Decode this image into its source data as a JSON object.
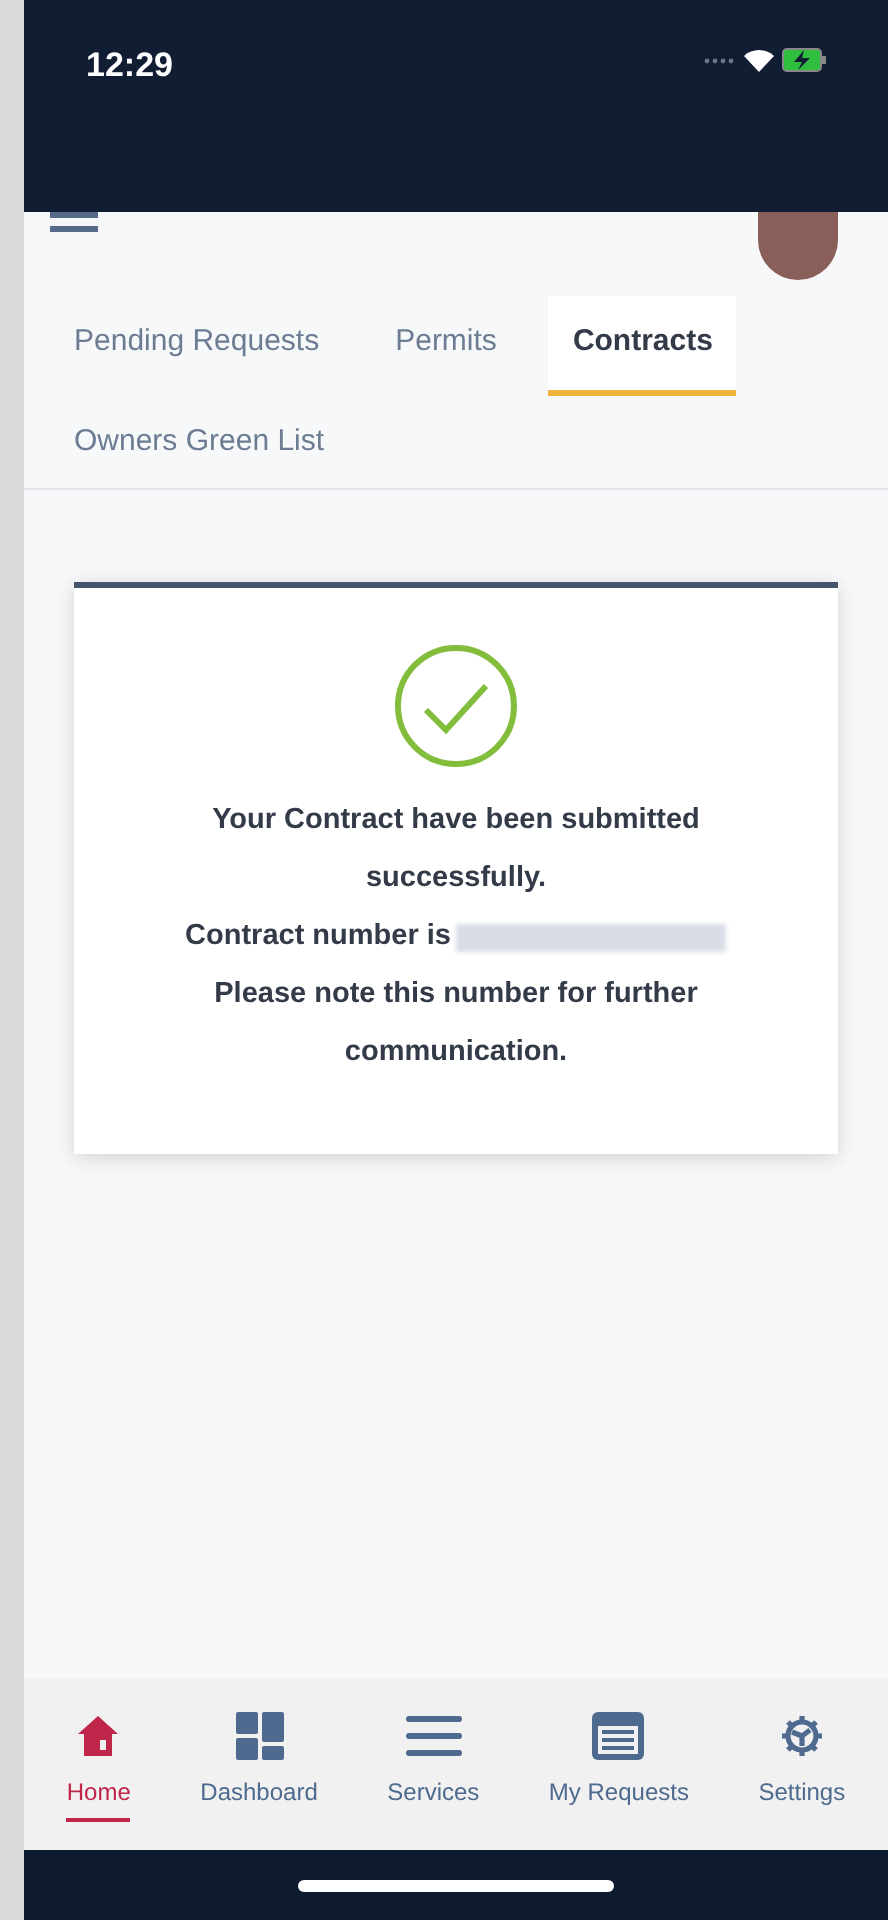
{
  "status_bar": {
    "time": "12:29"
  },
  "tabs": [
    {
      "label": "Pending Requests",
      "selected": false
    },
    {
      "label": "Permits",
      "selected": false
    },
    {
      "label": "Contracts",
      "selected": true
    },
    {
      "label": "Owners Green List",
      "selected": false
    }
  ],
  "confirmation": {
    "title_line": "Your Contract have been submitted successfully.",
    "number_label": "Contract number is",
    "note": "Please note this number for further communication."
  },
  "bottom_nav": [
    {
      "label": "Home",
      "kind": "home",
      "selected": true
    },
    {
      "label": "Dashboard",
      "kind": "dashboard",
      "selected": false
    },
    {
      "label": "Services",
      "kind": "services",
      "selected": false
    },
    {
      "label": "My Requests",
      "kind": "requests",
      "selected": false
    },
    {
      "label": "Settings",
      "kind": "settings",
      "selected": false
    }
  ]
}
